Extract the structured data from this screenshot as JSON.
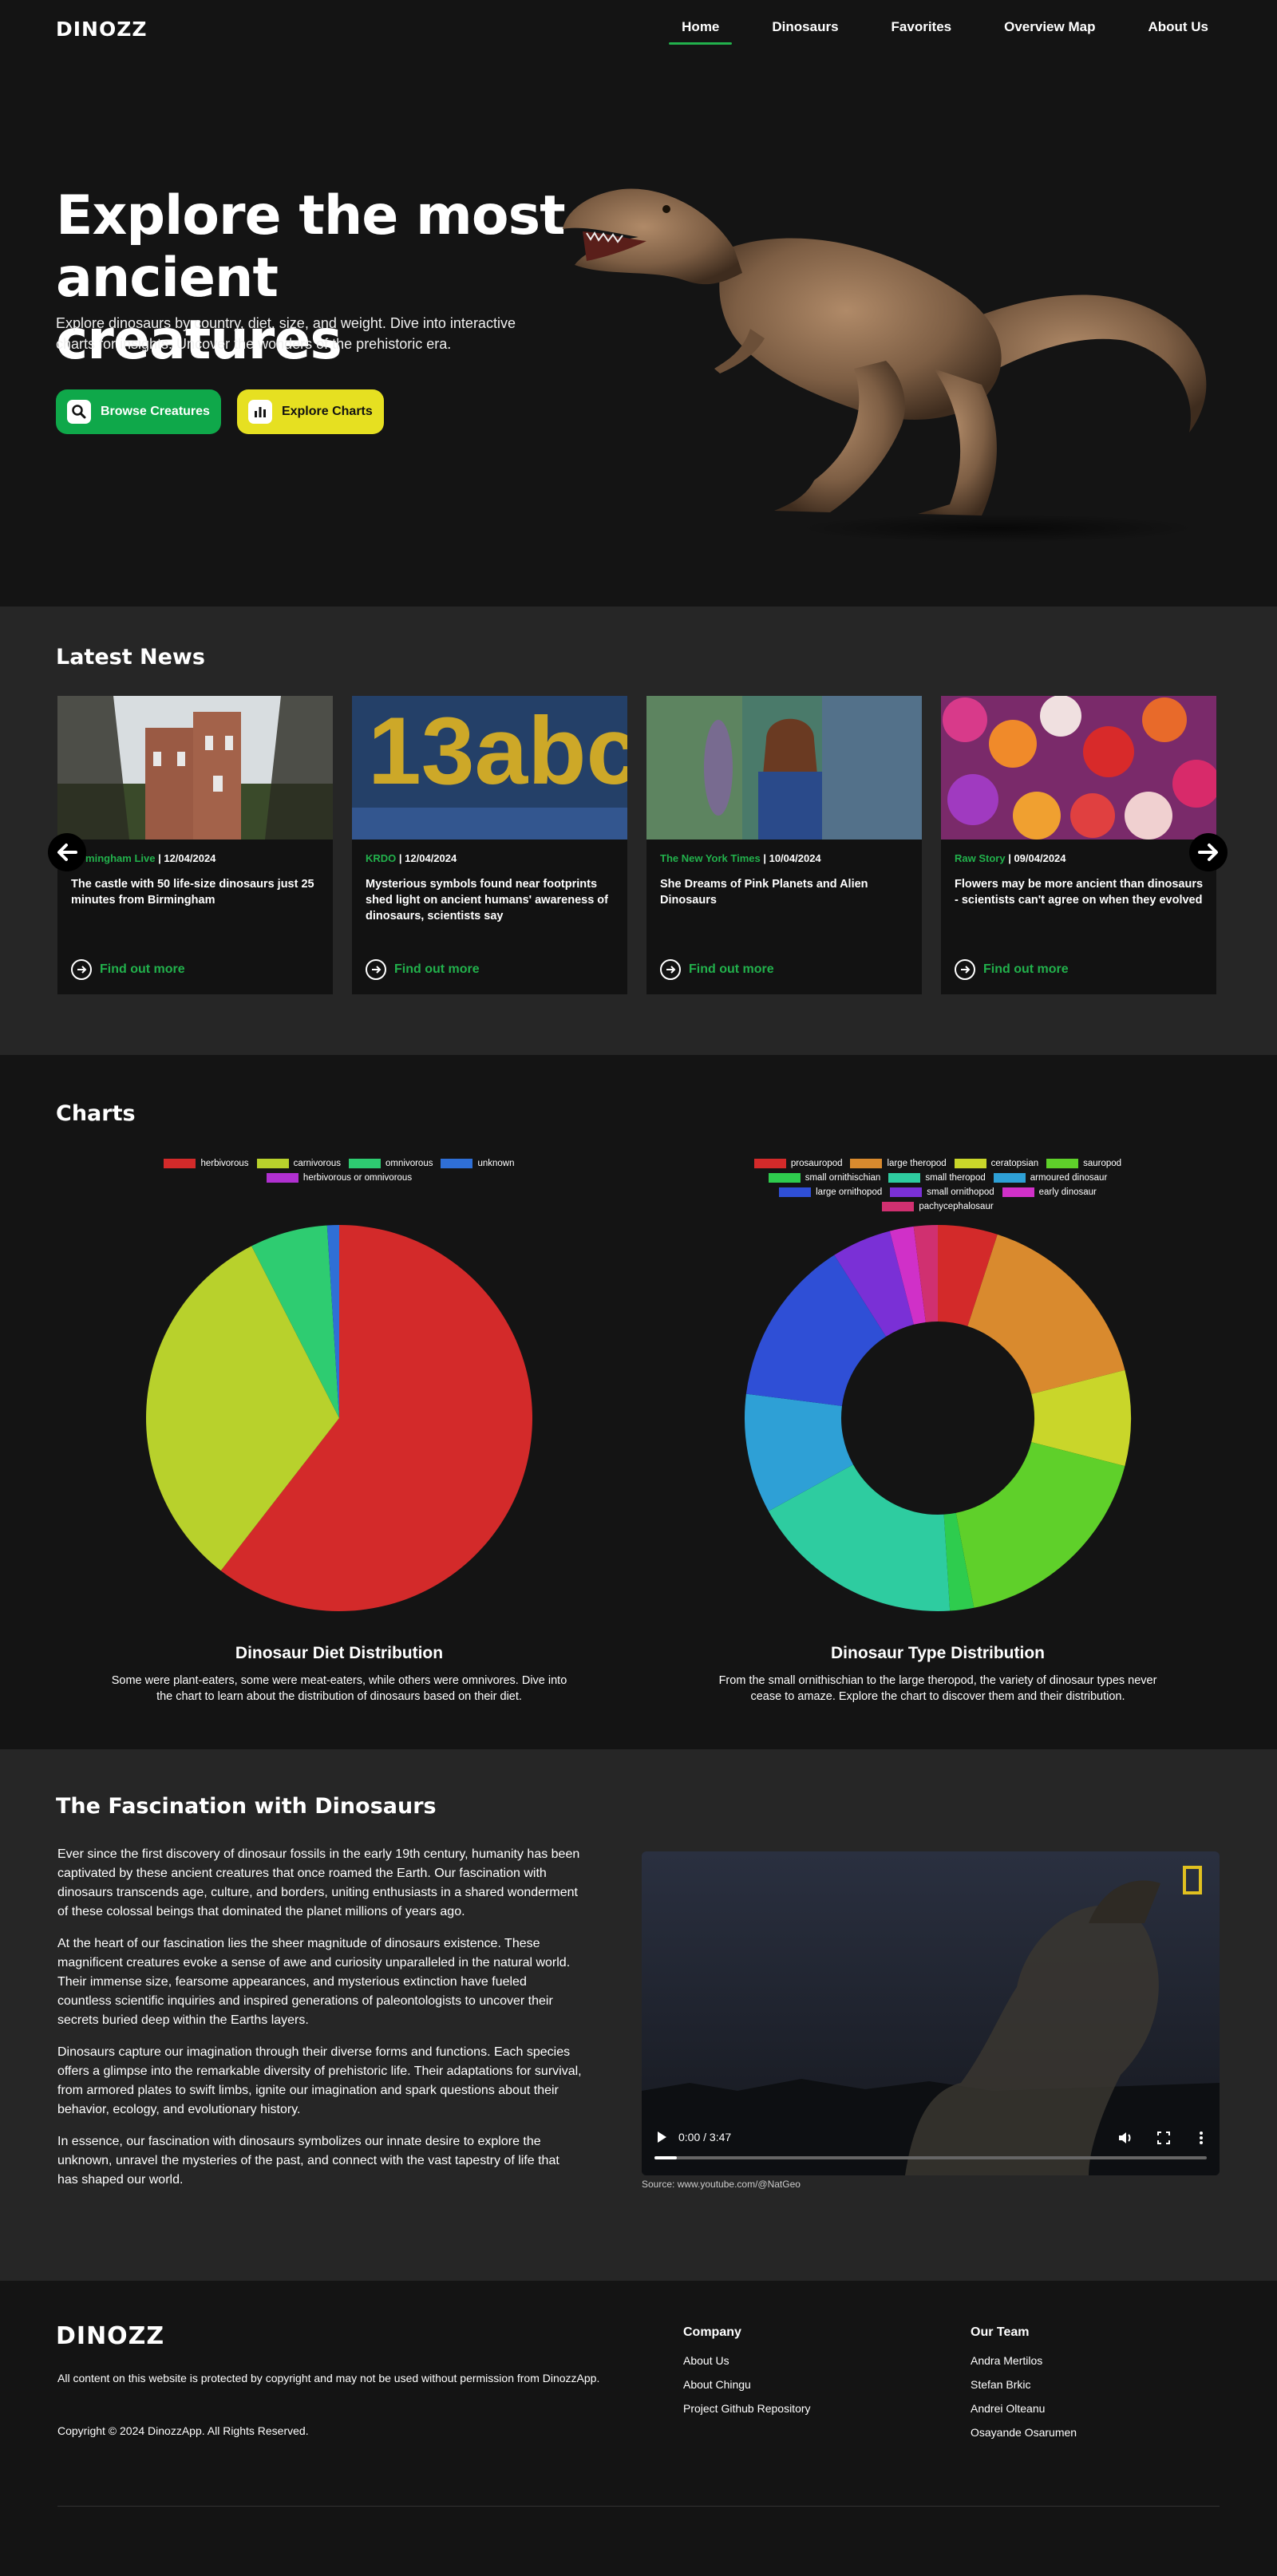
{
  "nav": {
    "logo": "DINOZZ",
    "links": [
      "Home",
      "Dinosaurs",
      "Favorites",
      "Overview Map",
      "About Us"
    ],
    "active": "Home"
  },
  "hero": {
    "title": "Explore the most ancient creatures",
    "subtitle": "Explore dinosaurs by country, diet, size, and weight. Dive into interactive charts for insights. Uncover the wonders of the prehistoric era.",
    "btn_browse": "Browse Creatures",
    "btn_charts": "Explore Charts"
  },
  "news": {
    "title": "Latest News",
    "cards": [
      {
        "source": "Birmingham Live",
        "date": "12/04/2024",
        "title": "The castle with 50 life-size dinosaurs just 25 minutes from Birmingham",
        "link": "Find out more"
      },
      {
        "source": "KRDO",
        "date": "12/04/2024",
        "title": "Mysterious symbols found near footprints shed light on ancient humans' awareness of dinosaurs, scientists say",
        "link": "Find out more"
      },
      {
        "source": "The New York Times",
        "date": "10/04/2024",
        "title": "She Dreams of Pink Planets and Alien Dinosaurs",
        "link": "Find out more"
      },
      {
        "source": "Raw Story",
        "date": "09/04/2024",
        "title": "Flowers may be more ancient than dinosaurs - scientists can't agree on when they evolved",
        "link": "Find out more"
      }
    ],
    "img_text": "13abc KRDO"
  },
  "charts": {
    "title": "Charts",
    "diet_title": "Dinosaur Diet Distribution",
    "diet_desc": "Some were plant-eaters, some were meat-eaters, while others were omnivores. Dive into the chart to learn about the distribution of dinosaurs based on their diet.",
    "type_title": "Dinosaur Type Distribution",
    "type_desc": "From the small ornithischian to the large theropod, the variety of dinosaur types never cease to amaze. Explore the chart to discover them and their distribution."
  },
  "chart_data": [
    {
      "type": "pie",
      "categories": [
        "herbivorous",
        "carnivorous",
        "omnivorous",
        "unknown",
        "herbivorous or omnivorous"
      ],
      "values": [
        60.5,
        32,
        6.5,
        1,
        0
      ],
      "colors": [
        "#d32a2a",
        "#b8d12c",
        "#2ecc71",
        "#2f6fd6",
        "#b030d0"
      ],
      "legend": "top"
    },
    {
      "type": "doughnut",
      "categories": [
        "prosauropod",
        "large theropod",
        "ceratopsian",
        "sauropod",
        "small ornithischian",
        "small theropod",
        "armoured dinosaur",
        "large ornithopod",
        "small ornithopod",
        "early dinosaur",
        "pachycephalosaur"
      ],
      "values": [
        5,
        16,
        8,
        18,
        2,
        18,
        10,
        14,
        5,
        2,
        2
      ],
      "colors": [
        "#d32a2a",
        "#d98a2e",
        "#c9d62a",
        "#5fd02a",
        "#2ecc4e",
        "#2ecca0",
        "#2ea0d6",
        "#2f4fd6",
        "#7a30d6",
        "#d030c8",
        "#d03070"
      ],
      "legend": "top"
    }
  ],
  "fascination": {
    "title": "The Fascination with Dinosaurs",
    "paragraphs": [
      "Ever since the first discovery of dinosaur fossils in the early 19th century, humanity has been captivated by these ancient creatures that once roamed the Earth. Our fascination with dinosaurs transcends age, culture, and borders, uniting enthusiasts in a shared wonderment of these colossal beings that dominated the planet millions of years ago.",
      "At the heart of our fascination lies the sheer magnitude of dinosaurs existence. These magnificent creatures evoke a sense of awe and curiosity unparalleled in the natural world. Their immense size, fearsome appearances, and mysterious extinction have fueled countless scientific inquiries and inspired generations of paleontologists to uncover their secrets buried deep within the Earths layers.",
      "Dinosaurs capture our imagination through their diverse forms and functions. Each species offers a glimpse into the remarkable diversity of prehistoric life. Their adaptations for survival, from armored plates to swift limbs, ignite our imagination and spark questions about their behavior, ecology, and evolutionary history.",
      "In essence, our fascination with dinosaurs symbolizes our innate desire to explore the unknown, unravel the mysteries of the past, and connect with the vast tapestry of life that has shaped our world."
    ],
    "video_time": "0:00 / 3:47",
    "video_progress": 0.04,
    "source": "Source: www.youtube.com/@NatGeo"
  },
  "footer": {
    "logo": "DINOZZ",
    "copy": "All content on this website is protected by copyright and may not be used without permission from DinozzApp.",
    "rights": "Copyright © 2024 DinozzApp. All Rights Reserved.",
    "company_title": "Company",
    "company": [
      "About Us",
      "About Chingu",
      "Project Github Repository"
    ],
    "team_title": "Our Team",
    "team": [
      "Andra Mertilos",
      "Stefan Brkic",
      "Andrei Olteanu",
      "Osayande Osarumen"
    ]
  },
  "colors": {
    "accent": "#22b14c",
    "yellow": "#e6e021",
    "bg": "#141414",
    "section": "#262626"
  }
}
